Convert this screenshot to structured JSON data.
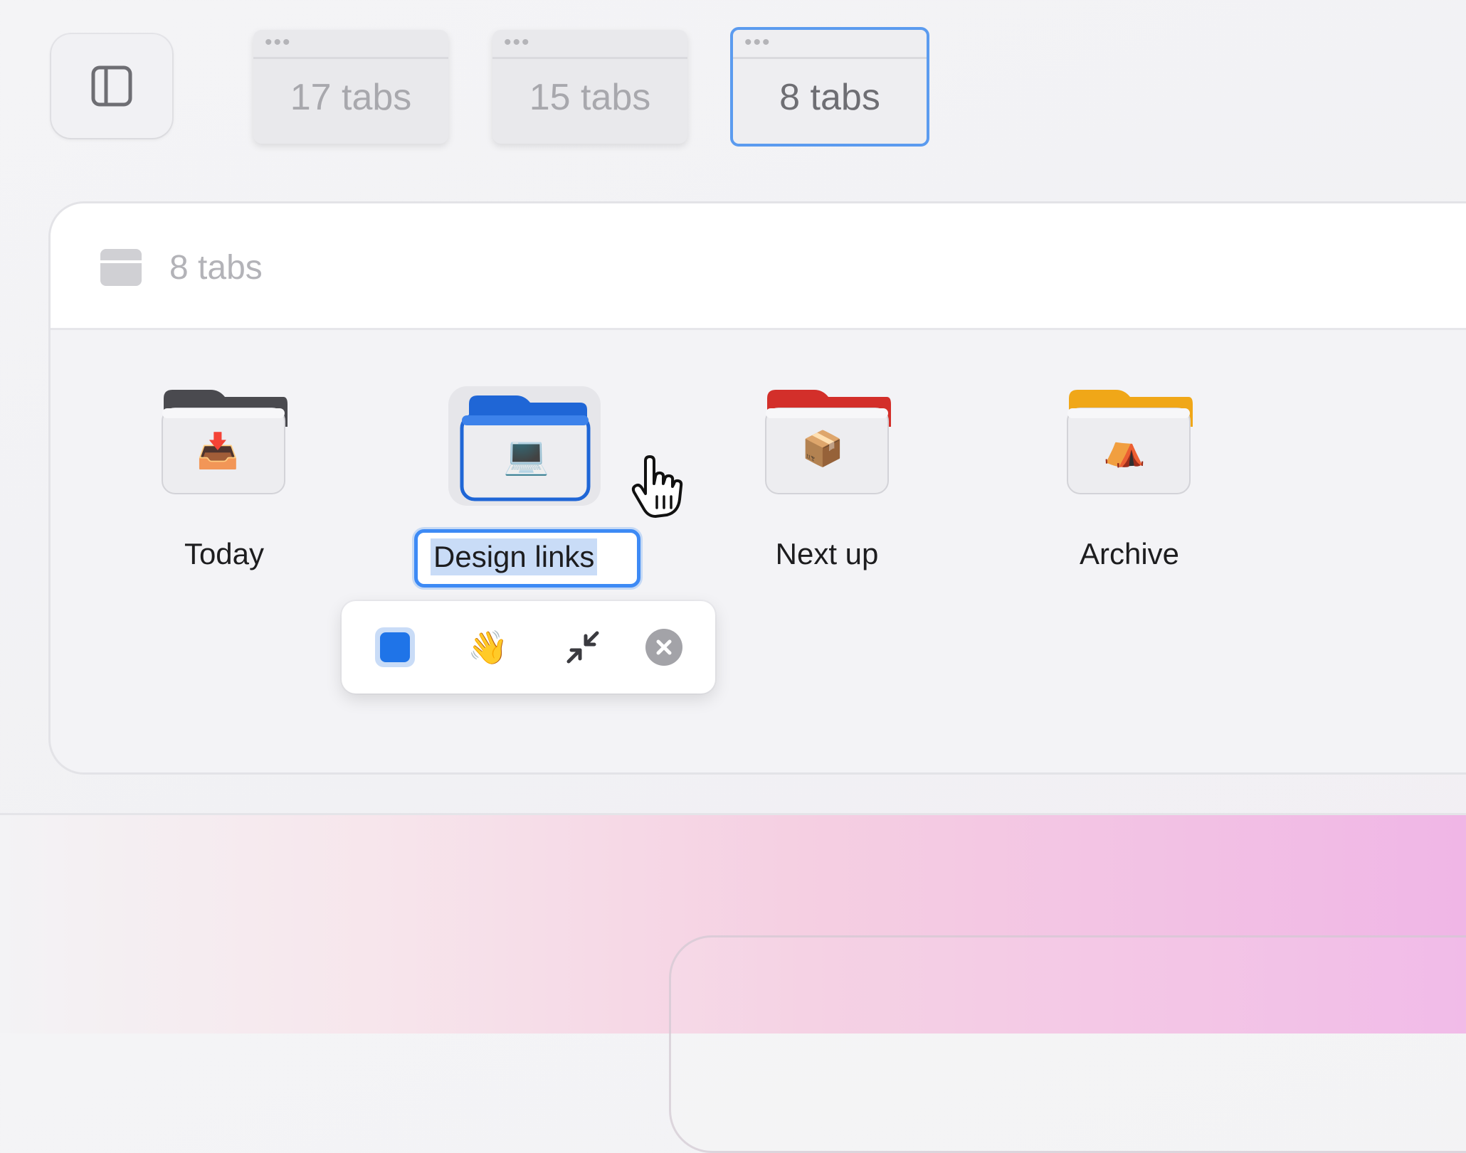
{
  "toolbar": {
    "sidebar_toggle_icon": "sidebar-icon",
    "spaces": [
      {
        "label": "17 tabs",
        "active": false
      },
      {
        "label": "15 tabs",
        "active": false
      },
      {
        "label": "8 tabs",
        "active": true
      }
    ],
    "dots": "•••"
  },
  "card": {
    "header_title": "8 tabs",
    "header_icon": "folder-tab-icon",
    "folders": [
      {
        "label": "Today",
        "icon": "inbox-tray-emoji",
        "color": "#4a4a4f"
      },
      {
        "label": "Design links",
        "icon": "laptop-emoji",
        "color": "#1f66d6",
        "editing": true
      },
      {
        "label": "Next up",
        "icon": "package-emoji",
        "color": "#d32f2a"
      },
      {
        "label": "Archive",
        "icon": "tent-emoji",
        "color": "#f0a718"
      }
    ]
  },
  "popover": {
    "color_swatch": "#1f74e8",
    "emoji_button": "👋",
    "collapse_icon": "collapse-arrows-icon",
    "close_icon": "close-circle-icon"
  }
}
